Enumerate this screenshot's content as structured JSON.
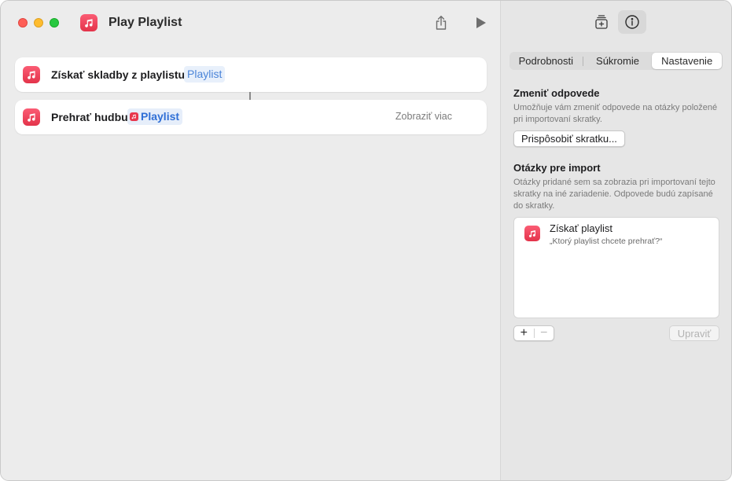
{
  "window": {
    "title": "Play Playlist",
    "app_icon": "shortcuts-music-icon"
  },
  "toolbar": {
    "share_icon": "share-icon",
    "run_icon": "play-icon"
  },
  "actions": [
    {
      "label": "Získať skladby z playlistu",
      "token": "Playlist",
      "icon": "music-note-icon"
    },
    {
      "label": "Prehrať hudbu",
      "token": "Playlist",
      "token_icon": "music-note-icon",
      "more": "Zobraziť viac",
      "icon": "music-note-icon"
    }
  ],
  "inspector": {
    "add_library_icon": "add-to-library-icon",
    "info_icon": "info-icon",
    "tabs": [
      {
        "label": "Podrobnosti",
        "selected": false
      },
      {
        "label": "Súkromie",
        "selected": false
      },
      {
        "label": "Nastavenie",
        "selected": true
      }
    ],
    "change_answers": {
      "title": "Zmeniť odpovede",
      "description": "Umožňuje vám zmeniť odpovede na otázky položené pri importovaní skratky.",
      "button": "Prispôsobiť skratku..."
    },
    "import_questions": {
      "title": "Otázky pre import",
      "description": "Otázky pridané sem sa zobrazia pri importovaní tejto skratky na iné zariadenie. Odpovede budú zapísané do skratky.",
      "items": [
        {
          "title": "Získať playlist",
          "subtitle": "„Ktorý playlist chcete prehrať?“"
        }
      ],
      "add": "+",
      "remove": "−",
      "edit": "Upraviť"
    }
  },
  "colors": {
    "accent_red": "#e8374d",
    "token_blue": "#4a84d8"
  }
}
